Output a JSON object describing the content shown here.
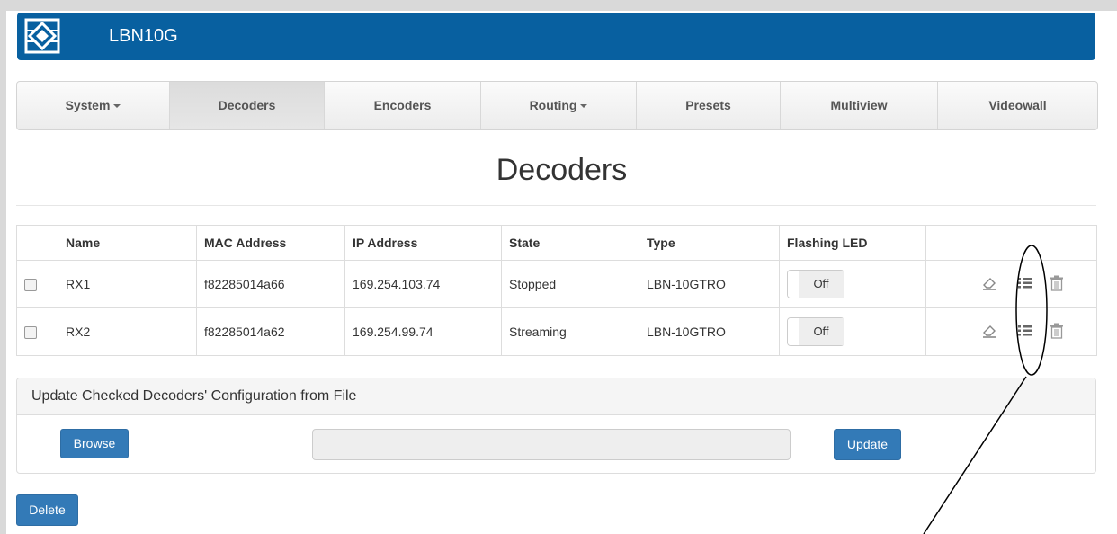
{
  "header": {
    "title": "LBN10G",
    "logo_icon": "company-logo-icon"
  },
  "nav": {
    "items": [
      {
        "label": "System",
        "dropdown": true,
        "active": false
      },
      {
        "label": "Decoders",
        "dropdown": false,
        "active": true
      },
      {
        "label": "Encoders",
        "dropdown": false,
        "active": false
      },
      {
        "label": "Routing",
        "dropdown": true,
        "active": false
      },
      {
        "label": "Presets",
        "dropdown": false,
        "active": false
      },
      {
        "label": "Multiview",
        "dropdown": false,
        "active": false
      },
      {
        "label": "Videowall",
        "dropdown": false,
        "active": false
      }
    ]
  },
  "page": {
    "title": "Decoders"
  },
  "table": {
    "columns": [
      "",
      "Name",
      "MAC Address",
      "IP Address",
      "State",
      "Type",
      "Flashing LED",
      ""
    ],
    "rows": [
      {
        "name": "RX1",
        "mac": "f82285014a66",
        "ip": "169.254.103.74",
        "state": "Stopped",
        "type": "LBN-10GTRO",
        "led": "Off",
        "checked": false
      },
      {
        "name": "RX2",
        "mac": "f82285014a62",
        "ip": "169.254.99.74",
        "state": "Streaming",
        "type": "LBN-10GTRO",
        "led": "Off",
        "checked": false
      }
    ],
    "row_action_icons": [
      "eraser-icon",
      "list-icon",
      "trash-icon"
    ]
  },
  "update_panel": {
    "heading": "Update Checked Decoders' Configuration from File",
    "browse_label": "Browse",
    "file_value": "",
    "update_label": "Update"
  },
  "footer": {
    "delete_label": "Delete"
  },
  "colors": {
    "header": "#0860a0",
    "primary_button": "#337ab7"
  }
}
